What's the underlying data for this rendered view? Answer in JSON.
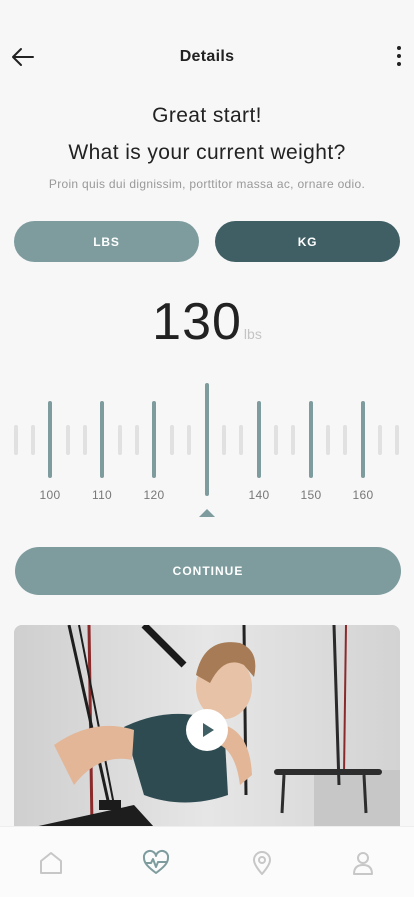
{
  "header": {
    "title": "Details"
  },
  "prompt": {
    "line1": "Great start!",
    "line2": "What is your current weight?",
    "subtitle": "Proin quis dui dignissim, porttitor massa ac, ornare odio."
  },
  "units": {
    "lbs_label": "LBS",
    "kg_label": "KG",
    "selected": "KG"
  },
  "weight": {
    "value": "130",
    "unit": "lbs"
  },
  "ruler": {
    "labels": [
      "100",
      "110",
      "120",
      "140",
      "150",
      "160"
    ],
    "selected_value": 130
  },
  "continue_label": "CONTINUE",
  "tabbar": {
    "items": [
      "home-icon",
      "activity-icon",
      "location-icon",
      "profile-icon"
    ],
    "active": "activity-icon"
  },
  "colors": {
    "accent": "#7e9c9e",
    "accent_dark": "#3f5f65"
  }
}
